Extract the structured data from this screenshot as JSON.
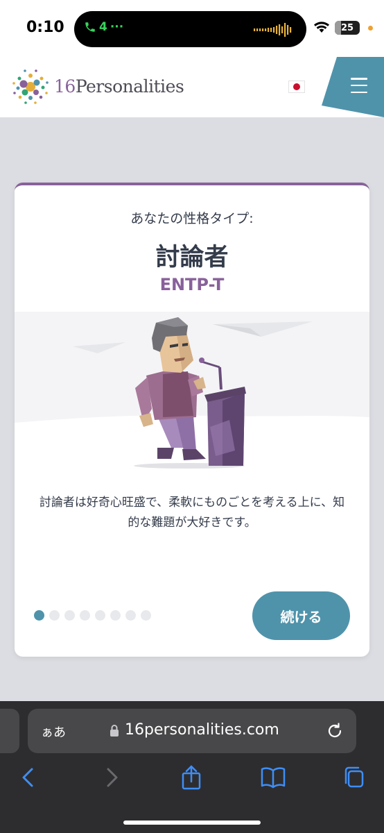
{
  "status_bar": {
    "time": "0:10",
    "call_label": "4",
    "call_dots": "···",
    "battery": "25",
    "battery_level": 0.25
  },
  "header": {
    "logo_number": "16",
    "logo_name": "Personalities",
    "flag": "japan-flag-icon",
    "menu_icon": "hamburger-menu-icon",
    "brand_color": "#88619a",
    "accent_color": "#4f93ab"
  },
  "card": {
    "label": "あなたの性格タイプ:",
    "title": "討論者",
    "code": "ENTP-T",
    "description": "討論者は好奇心旺盛で、柔軟にものごとを考える上に、知的な難題が大好きです。",
    "pager": {
      "total": 8,
      "active": 1
    },
    "continue_label": "続ける"
  },
  "browser": {
    "reader_label": "ぁあ",
    "url": "16personalities.com",
    "lock_icon": "lock-icon",
    "reload_icon": "reload-icon",
    "nav_icons": [
      "back-icon",
      "forward-icon",
      "share-icon",
      "bookmarks-icon",
      "tabs-icon"
    ]
  }
}
